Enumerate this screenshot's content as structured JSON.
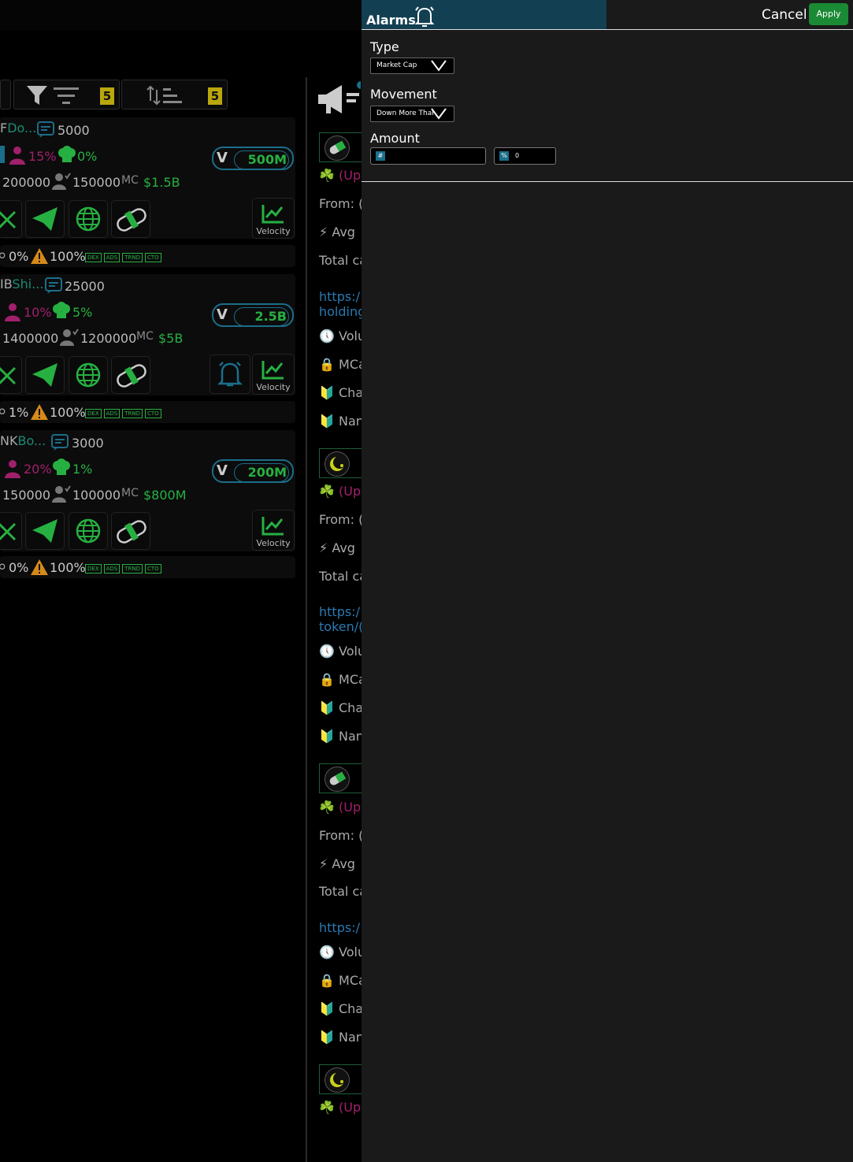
{
  "alarms_panel": {
    "title": "Alarms",
    "cancel_label": "Cancel",
    "apply_label": "Apply",
    "type_label": "Type",
    "type_value": "Market Cap",
    "movement_label": "Movement",
    "movement_value": "Down More Than",
    "amount_label": "Amount",
    "amount_hash_prefix": "#",
    "amount_hash_value": "",
    "amount_percent_prefix": "%",
    "amount_percent_value": "0"
  },
  "toolbar": {
    "filter_count": "5",
    "sort_count": "5"
  },
  "cards": [
    {
      "ticker": "F",
      "name": "Do...",
      "comments": "5000",
      "pct_a": "15%",
      "pct_b": "0%",
      "volume": "500M",
      "holders": "200000",
      "verified": "150000",
      "mc_label": "MC",
      "mc": "$1.5B",
      "velocity_label": "Velocity",
      "foot_a": "0%",
      "foot_b": "100%",
      "tags": [
        "DEX",
        "ADS",
        "TRND",
        "CTO"
      ]
    },
    {
      "ticker": "IB",
      "name": "Shi...",
      "comments": "25000",
      "pct_a": "10%",
      "pct_b": "5%",
      "volume": "2.5B",
      "holders": "1400000",
      "verified": "1200000",
      "mc_label": "MC",
      "mc": "$5B",
      "velocity_label": "Velocity",
      "foot_a": "1%",
      "foot_b": "100%",
      "tags": [
        "DEX",
        "ADS",
        "TRND",
        "CTO"
      ]
    },
    {
      "ticker": "NK",
      "name": "Bo...",
      "comments": "3000",
      "pct_a": "20%",
      "pct_b": "1%",
      "volume": "200M",
      "holders": "150000",
      "verified": "100000",
      "mc_label": "MC",
      "mc": "$800M",
      "velocity_label": "Velocity",
      "foot_a": "0%",
      "foot_b": "100%",
      "tags": [
        "DEX",
        "ADS",
        "TRND",
        "CTO"
      ]
    }
  ],
  "feed": [
    {
      "l1": "☘️ (Up",
      "l2": "From: (",
      "l3": "⚡ Avg",
      "l4": "Total ca",
      "link1": "https:/",
      "link2": "holding",
      "l5": "🕔 Volu",
      "l6": "🔒 MCa",
      "l7": "🔰 Cha",
      "l8": "🔰 Nan"
    },
    {
      "l1": "☘️ (Up",
      "l2": "From: (",
      "l3": "⚡ Avg",
      "l4": "Total ca",
      "link1": "https:/",
      "link2": "token/(",
      "l5": "🕔 Volu",
      "l6": "🔒 MCa",
      "l7": "🔰 Cha",
      "l8": "🔰 Nan"
    },
    {
      "l1": "☘️ (Up",
      "l2": "From: (",
      "l3": "⚡ Avg",
      "l4": "Total ca",
      "link1": "https:/",
      "link2": "",
      "l5": "🕔 Volu",
      "l6": "🔒 MCa",
      "l7": "🔰 Cha",
      "l8": "🔰 Nan"
    },
    {
      "l1": "☘️ (Up"
    }
  ],
  "colors": {
    "accent_teal": "#1b6e8a",
    "green": "#27b042",
    "pink": "#a0206b",
    "apply_bg": "#1b8a35"
  }
}
